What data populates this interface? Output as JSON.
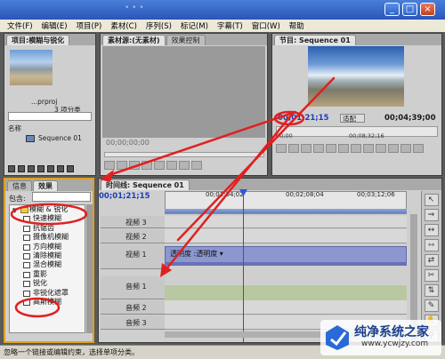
{
  "titlebar": {
    "hint": "• • •",
    "min": "_",
    "max": "□",
    "close": "×"
  },
  "menubar": {
    "items": [
      "文件(F)",
      "编辑(E)",
      "项目(P)",
      "素材(C)",
      "序列(S)",
      "标记(M)",
      "字幕(T)",
      "窗口(W)",
      "帮助"
    ]
  },
  "project": {
    "tab": "项目:模糊与锐化",
    "file": "...prproj",
    "count": "3 项分类",
    "col_name": "名称",
    "sequence": "Sequence 01"
  },
  "source": {
    "tab1": "素材源:(无素材)",
    "tab2": "效果控制",
    "timecode": "00;00;00;00"
  },
  "program": {
    "tab": "节目: Sequence 01",
    "tc_current": "00;01;21;15",
    "fit": "适配",
    "tc_duration": "00;04;39;00",
    "ruler_left": "00;00",
    "ruler_mid": "00;08;32;16"
  },
  "effects": {
    "tab_info": "信息",
    "tab_effects": "效果",
    "contains": "包含:",
    "folder": "模糊 & 锐化",
    "items": [
      "快速模糊",
      "抗锯齿",
      "摄像机模糊",
      "方向模糊",
      "清除模糊",
      "混合模糊",
      "重影",
      "锐化",
      "非锐化遮罩",
      "高斯模糊"
    ]
  },
  "timeline": {
    "tab": "时间线: Sequence 01",
    "timecode": "00;01;21;15",
    "ticks": [
      "00;01;04;02",
      "00;02;08;04",
      "00;03;12;06"
    ],
    "tracks": [
      {
        "label": "视频 3"
      },
      {
        "label": "视频 2"
      },
      {
        "label": "视频 1"
      },
      {
        "label": "音频 1"
      },
      {
        "label": "音频 2"
      },
      {
        "label": "音频 3"
      }
    ],
    "clip_label": "透明度 :透明度 ▾"
  },
  "status": "忽略一个链接或编辑约束，选择单项分类。",
  "watermark": {
    "title": "纯净系统之家",
    "url": "www.ycwjzy.com"
  },
  "colors": {
    "annotation": "#e02020",
    "timecode": "#1a3cb8",
    "panel_border": "#e0a020"
  }
}
